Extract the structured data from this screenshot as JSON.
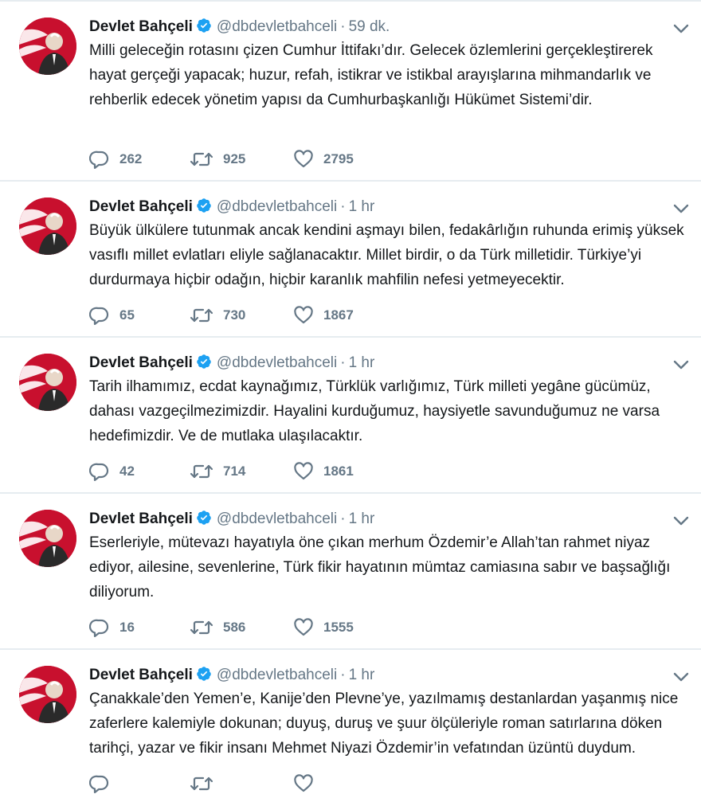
{
  "author": {
    "name": "Devlet Bahçeli",
    "handle": "@dbdevletbahceli"
  },
  "colors": {
    "verified": "#1da1f2",
    "meta": "#657786",
    "divider": "#e6ecf0",
    "avatar_brand": "#c8102e"
  },
  "icons": {
    "reply": "reply-icon",
    "retweet": "retweet-icon",
    "like": "heart-icon",
    "menu": "chevron-down-icon",
    "verified": "verified-badge-icon"
  },
  "tweets": [
    {
      "time": "59 dk.",
      "text": "Milli geleceğin rotasını çizen Cumhur İttifakı’dır. Gelecek özlemlerini gerçekleştirerek hayat gerçeği yapacak; huzur, refah, istikrar ve istikbal arayışlarına mihmandarlık ve rehberlik edecek yönetim yapısı da Cumhurbaşkanlığı Hükümet Sistemi’dir.",
      "replies": "262",
      "retweets": "925",
      "likes": "2795"
    },
    {
      "time": "1 hr",
      "text": "Büyük ülkülere tutunmak ancak kendini aşmayı bilen, fedakârlığın ruhunda erimiş yüksek vasıflı millet evlatları eliyle sağlanacaktır. Millet birdir, o da Türk milletidir. Türkiye’yi durdurmaya hiçbir odağın, hiçbir karanlık mahfilin nefesi yetmeyecektir.",
      "replies": "65",
      "retweets": "730",
      "likes": "1867"
    },
    {
      "time": "1 hr",
      "text": "Tarih ilhamımız, ecdat kaynağımız, Türklük varlığımız, Türk milleti yegâne gücümüz, dahası vazgeçilmezimizdir. Hayalini kurduğumuz, haysiyetle savunduğumuz ne varsa hedefimizdir. Ve de mutlaka ulaşılacaktır.",
      "replies": "42",
      "retweets": "714",
      "likes": "1861"
    },
    {
      "time": "1 hr",
      "text": "Eserleriyle, mütevazı hayatıyla öne çıkan merhum Özdemir’e Allah’tan rahmet niyaz ediyor, ailesine, sevenlerine, Türk fikir hayatının mümtaz camiasına sabır ve başsağlığı diliyorum.",
      "replies": "16",
      "retweets": "586",
      "likes": "1555"
    },
    {
      "time": "1 hr",
      "text": "Çanakkale’den Yemen’e, Kanije’den Plevne’ye, yazılmamış destanlardan yaşanmış nice zaferlere kalemiyle dokunan; duyuş, duruş ve şuur ölçüleriyle roman satırlarına döken tarihçi, yazar ve fikir insanı Mehmet Niyazi Özdemir’in vefatından üzüntü duydum.",
      "replies": "",
      "retweets": "",
      "likes": ""
    }
  ]
}
